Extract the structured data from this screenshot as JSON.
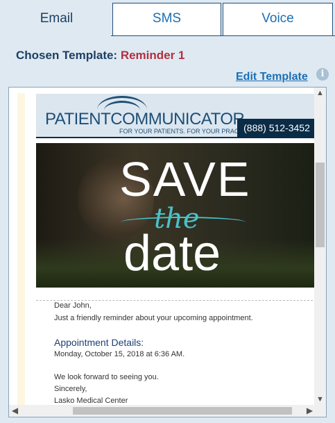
{
  "tabs": [
    {
      "label": "Email",
      "active": true
    },
    {
      "label": "SMS",
      "active": false
    },
    {
      "label": "Voice",
      "active": false
    }
  ],
  "chosen_template": {
    "label": "Chosen Template:",
    "name": "Reminder 1"
  },
  "edit_template_label": "Edit Template",
  "info_icon": "i",
  "email": {
    "brand": "PATIENTCOMMUNICATOR",
    "tagline": "FOR YOUR PATIENTS.  FOR YOUR PRACTICE.",
    "phone": "(888) 512-3452",
    "hero": {
      "line1": "SAVE",
      "line2": "the",
      "line3": "date"
    },
    "greeting": "Dear John,",
    "intro": "Just a friendly reminder about your upcoming appointment.",
    "details_heading": "Appointment Details:",
    "appointment": "Monday, October 15, 2018 at 6:36 AM.",
    "closing": "We look forward to seeing you.",
    "signoff": "Sincerely,",
    "sender": "Lasko Medical Center"
  },
  "colors": {
    "accent": "#1a6fb5",
    "template_name": "#b03040",
    "navy": "#0b2c46",
    "teal": "#4ac1c9"
  }
}
